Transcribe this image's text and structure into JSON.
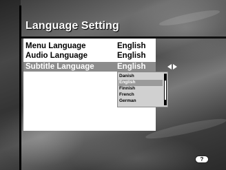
{
  "title": "Language Setting",
  "settings": [
    {
      "label": "Menu Language",
      "value": "English"
    },
    {
      "label": "Audio Language",
      "value": "English"
    },
    {
      "label": "Subtitle Language",
      "value": "English"
    }
  ],
  "dropdown": {
    "options": [
      "Danish",
      "English",
      "Finnish",
      "French",
      "German"
    ],
    "selected": "English"
  },
  "help_button": "?"
}
